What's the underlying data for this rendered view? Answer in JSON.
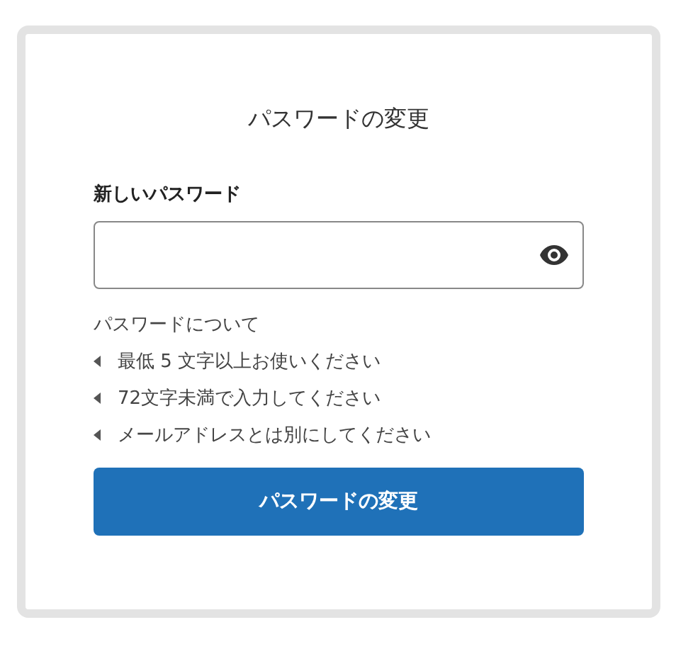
{
  "title": "パスワードの変更",
  "field": {
    "label": "新しいパスワード"
  },
  "rules": {
    "heading": "パスワードについて",
    "items": [
      "最低 5 文字以上お使いください",
      "72文字未満で入力してください",
      "メールアドレスとは別にしてください"
    ]
  },
  "submit": {
    "label": "パスワードの変更"
  }
}
